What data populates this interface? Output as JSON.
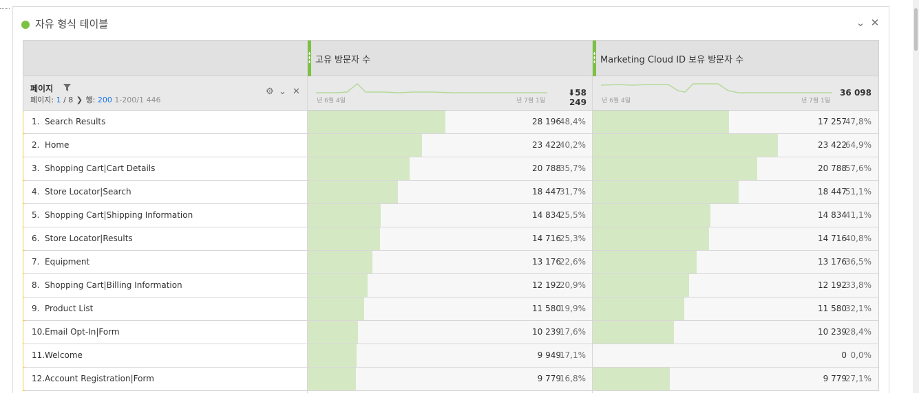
{
  "panel": {
    "title": "자유 형식 테이블",
    "status_color": "#7cc143",
    "collapse_icon": "chevron-down-icon",
    "close_icon": "close-icon"
  },
  "table": {
    "dimension": {
      "label": "페이지",
      "pager": {
        "page_label": "페이지:",
        "page_current": "1",
        "page_total": "/ 8",
        "rows_label": "행:",
        "rows_value": "200",
        "range": "1-200/1 446"
      }
    },
    "metrics": [
      {
        "name": "고유 방문자 수",
        "total": "58 249",
        "spark_start": "년 6월 4일",
        "spark_end": "년 7월 1일",
        "sorted": true
      },
      {
        "name": "Marketing Cloud ID 보유 방문자 수",
        "total": "36 098",
        "spark_start": "년 6월 4일",
        "spark_end": "년 7월 1일",
        "sorted": false
      }
    ],
    "rows": [
      {
        "idx": "1.",
        "label": "Search Results",
        "m1": {
          "value": "28 196",
          "pct": "48,4%",
          "fraction": 0.484
        },
        "m2": {
          "value": "17 257",
          "pct": "47,8%",
          "fraction": 0.478
        }
      },
      {
        "idx": "2.",
        "label": "Home",
        "m1": {
          "value": "23 422",
          "pct": "40,2%",
          "fraction": 0.402
        },
        "m2": {
          "value": "23 422",
          "pct": "64,9%",
          "fraction": 0.649
        }
      },
      {
        "idx": "3.",
        "label": "Shopping Cart|Cart Details",
        "m1": {
          "value": "20 788",
          "pct": "35,7%",
          "fraction": 0.357
        },
        "m2": {
          "value": "20 788",
          "pct": "57,6%",
          "fraction": 0.576
        }
      },
      {
        "idx": "4.",
        "label": "Store Locator|Search",
        "m1": {
          "value": "18 447",
          "pct": "31,7%",
          "fraction": 0.317
        },
        "m2": {
          "value": "18 447",
          "pct": "51,1%",
          "fraction": 0.511
        }
      },
      {
        "idx": "5.",
        "label": "Shopping Cart|Shipping Information",
        "m1": {
          "value": "14 834",
          "pct": "25,5%",
          "fraction": 0.255
        },
        "m2": {
          "value": "14 834",
          "pct": "41,1%",
          "fraction": 0.411
        }
      },
      {
        "idx": "6.",
        "label": "Store Locator|Results",
        "m1": {
          "value": "14 716",
          "pct": "25,3%",
          "fraction": 0.253
        },
        "m2": {
          "value": "14 716",
          "pct": "40,8%",
          "fraction": 0.408
        }
      },
      {
        "idx": "7.",
        "label": "Equipment",
        "m1": {
          "value": "13 176",
          "pct": "22,6%",
          "fraction": 0.226
        },
        "m2": {
          "value": "13 176",
          "pct": "36,5%",
          "fraction": 0.365
        }
      },
      {
        "idx": "8.",
        "label": "Shopping Cart|Billing Information",
        "m1": {
          "value": "12 192",
          "pct": "20,9%",
          "fraction": 0.209
        },
        "m2": {
          "value": "12 192",
          "pct": "33,8%",
          "fraction": 0.338
        }
      },
      {
        "idx": "9.",
        "label": "Product List",
        "m1": {
          "value": "11 580",
          "pct": "19,9%",
          "fraction": 0.199
        },
        "m2": {
          "value": "11 580",
          "pct": "32,1%",
          "fraction": 0.321
        }
      },
      {
        "idx": "10.",
        "label": "Email Opt-In|Form",
        "m1": {
          "value": "10 239",
          "pct": "17,6%",
          "fraction": 0.176
        },
        "m2": {
          "value": "10 239",
          "pct": "28,4%",
          "fraction": 0.284
        }
      },
      {
        "idx": "11.",
        "label": "Welcome",
        "m1": {
          "value": "9 949",
          "pct": "17,1%",
          "fraction": 0.171
        },
        "m2": {
          "value": "0",
          "pct": "0,0%",
          "fraction": 0.0
        }
      },
      {
        "idx": "12.",
        "label": "Account Registration|Form",
        "m1": {
          "value": "9 779",
          "pct": "16,8%",
          "fraction": 0.168
        },
        "m2": {
          "value": "9 779",
          "pct": "27,1%",
          "fraction": 0.271
        }
      }
    ]
  },
  "colors": {
    "bar": "#d5e8c4",
    "accent": "#7cc143",
    "row_marker": "#f5c342",
    "link": "#1473e6"
  }
}
